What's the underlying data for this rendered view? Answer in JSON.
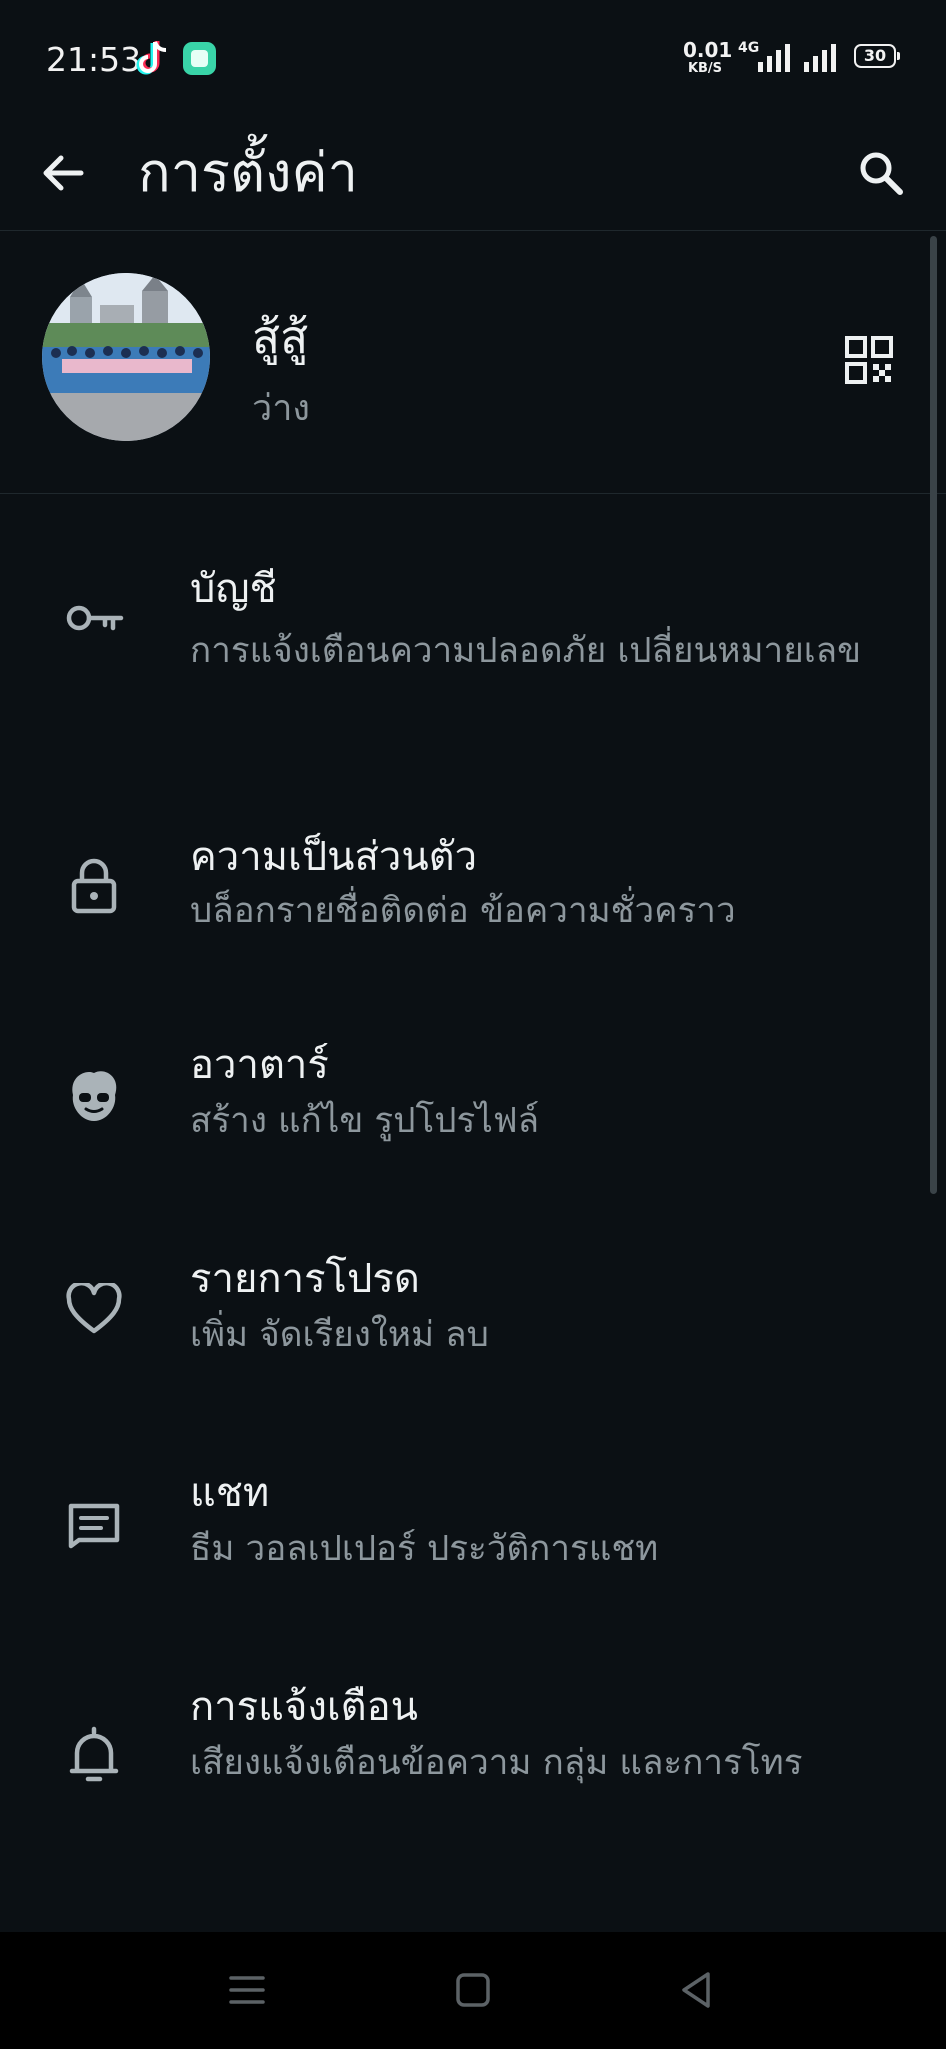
{
  "status_bar": {
    "time": "21:53",
    "net_speed_value": "0.01",
    "net_speed_unit": "KB/S",
    "network_type": "4G",
    "battery": "30",
    "icons": [
      "tiktok-icon",
      "app-notification-icon",
      "signal-icon",
      "battery-icon"
    ]
  },
  "app_bar": {
    "title": "การตั้งค่า",
    "back_icon": "arrow-left-icon",
    "search_icon": "search-icon"
  },
  "profile": {
    "name": "สู้สู้",
    "status": "ว่าง",
    "qr_icon": "qr-code-icon"
  },
  "items": [
    {
      "icon": "key-icon",
      "title": "บัญชี",
      "subtitle": "การแจ้งเตือนความปลอดภัย เปลี่ยนหมายเลข"
    },
    {
      "icon": "lock-icon",
      "title": "ความเป็นส่วนตัว",
      "subtitle": "บล็อกรายชื่อติดต่อ ข้อความชั่วคราว"
    },
    {
      "icon": "avatar-icon",
      "title": "อวาตาร์",
      "subtitle": "สร้าง แก้ไข รูปโปรไฟล์"
    },
    {
      "icon": "heart-icon",
      "title": "รายการโปรด",
      "subtitle": "เพิ่ม จัดเรียงใหม่ ลบ"
    },
    {
      "icon": "chat-icon",
      "title": "แชท",
      "subtitle": "ธีม วอลเปเปอร์ ประวัติการแชท"
    },
    {
      "icon": "bell-icon",
      "title": "การแจ้งเตือน",
      "subtitle": "เสียงแจ้งเตือนข้อความ กลุ่ม และการโทร"
    }
  ],
  "nav_bar": {
    "icons": [
      "menu-icon",
      "home-icon",
      "back-icon"
    ]
  },
  "colors": {
    "background": "#0b1014",
    "text_primary": "#eef1f2",
    "text_secondary": "#8d979d",
    "icon": "#aab3b8"
  }
}
